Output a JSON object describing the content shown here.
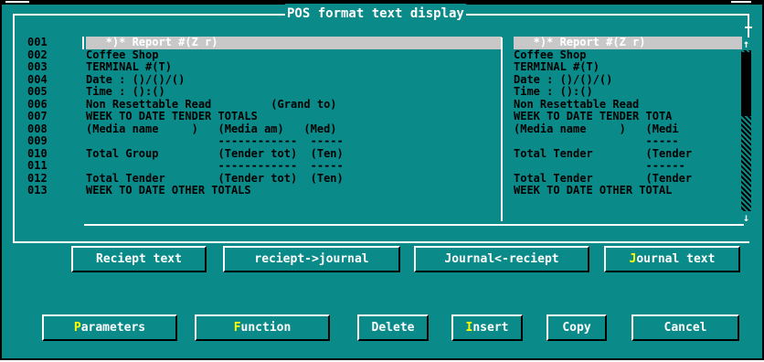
{
  "window": {
    "title": "POS format text display"
  },
  "line_numbers": [
    "001",
    "002",
    "003",
    "004",
    "005",
    "006",
    "007",
    "008",
    "009",
    "010",
    "011",
    "012",
    "013"
  ],
  "receipt_lines": [
    "   *)* Report #(Z r)",
    "Coffee Shop",
    "TERMINAL #(T)",
    "Date : ()/()/()",
    "Time : ():()",
    "Non Resettable Read         (Grand to)",
    "WEEK TO DATE TENDER TOTALS",
    "(Media name     )   (Media am)   (Med)",
    "                    ------------  -----",
    "Total Group         (Tender tot)  (Ten)",
    "                    ------------  -----",
    "Total Tender        (Tender tot)  (Ten)",
    "WEEK TO DATE OTHER TOTALS"
  ],
  "journal_lines": [
    "   *)* Report #(Z r)",
    "Coffee Shop",
    "TERMINAL #(T)",
    "Date : ()/()/()",
    "Time : ():()",
    "Non Resettable Read",
    "WEEK TO DATE TENDER TOTA",
    "(Media name     )   (Medi",
    "                    -----",
    "Total Tender        (Tender",
    "                    ------",
    "Total Tender        (Tender",
    "WEEK TO DATE OTHER TOTAL"
  ],
  "scrollbar": {
    "up_arrow": "↑",
    "down_arrow": "↓"
  },
  "buttons_row1": {
    "receipt_text": "Reciept text",
    "receipt_to_journal": "reciept->journal",
    "journal_from_receipt": "Journal<-reciept",
    "journal_text_hotkey": "J",
    "journal_text_rest": "ournal text"
  },
  "buttons_row2": {
    "parameters_hotkey": "P",
    "parameters_rest": "arameters",
    "function_hotkey": "F",
    "function_rest": "unction",
    "delete": "Delete",
    "insert_hotkey": "I",
    "insert_rest": "nsert",
    "copy": "Copy",
    "cancel": "Cancel"
  },
  "colors": {
    "background": "#0b8a8a",
    "text": "#000000",
    "highlight_text": "#ffffff",
    "hotkey": "#ffff00",
    "selection": "#c8c8c8"
  }
}
